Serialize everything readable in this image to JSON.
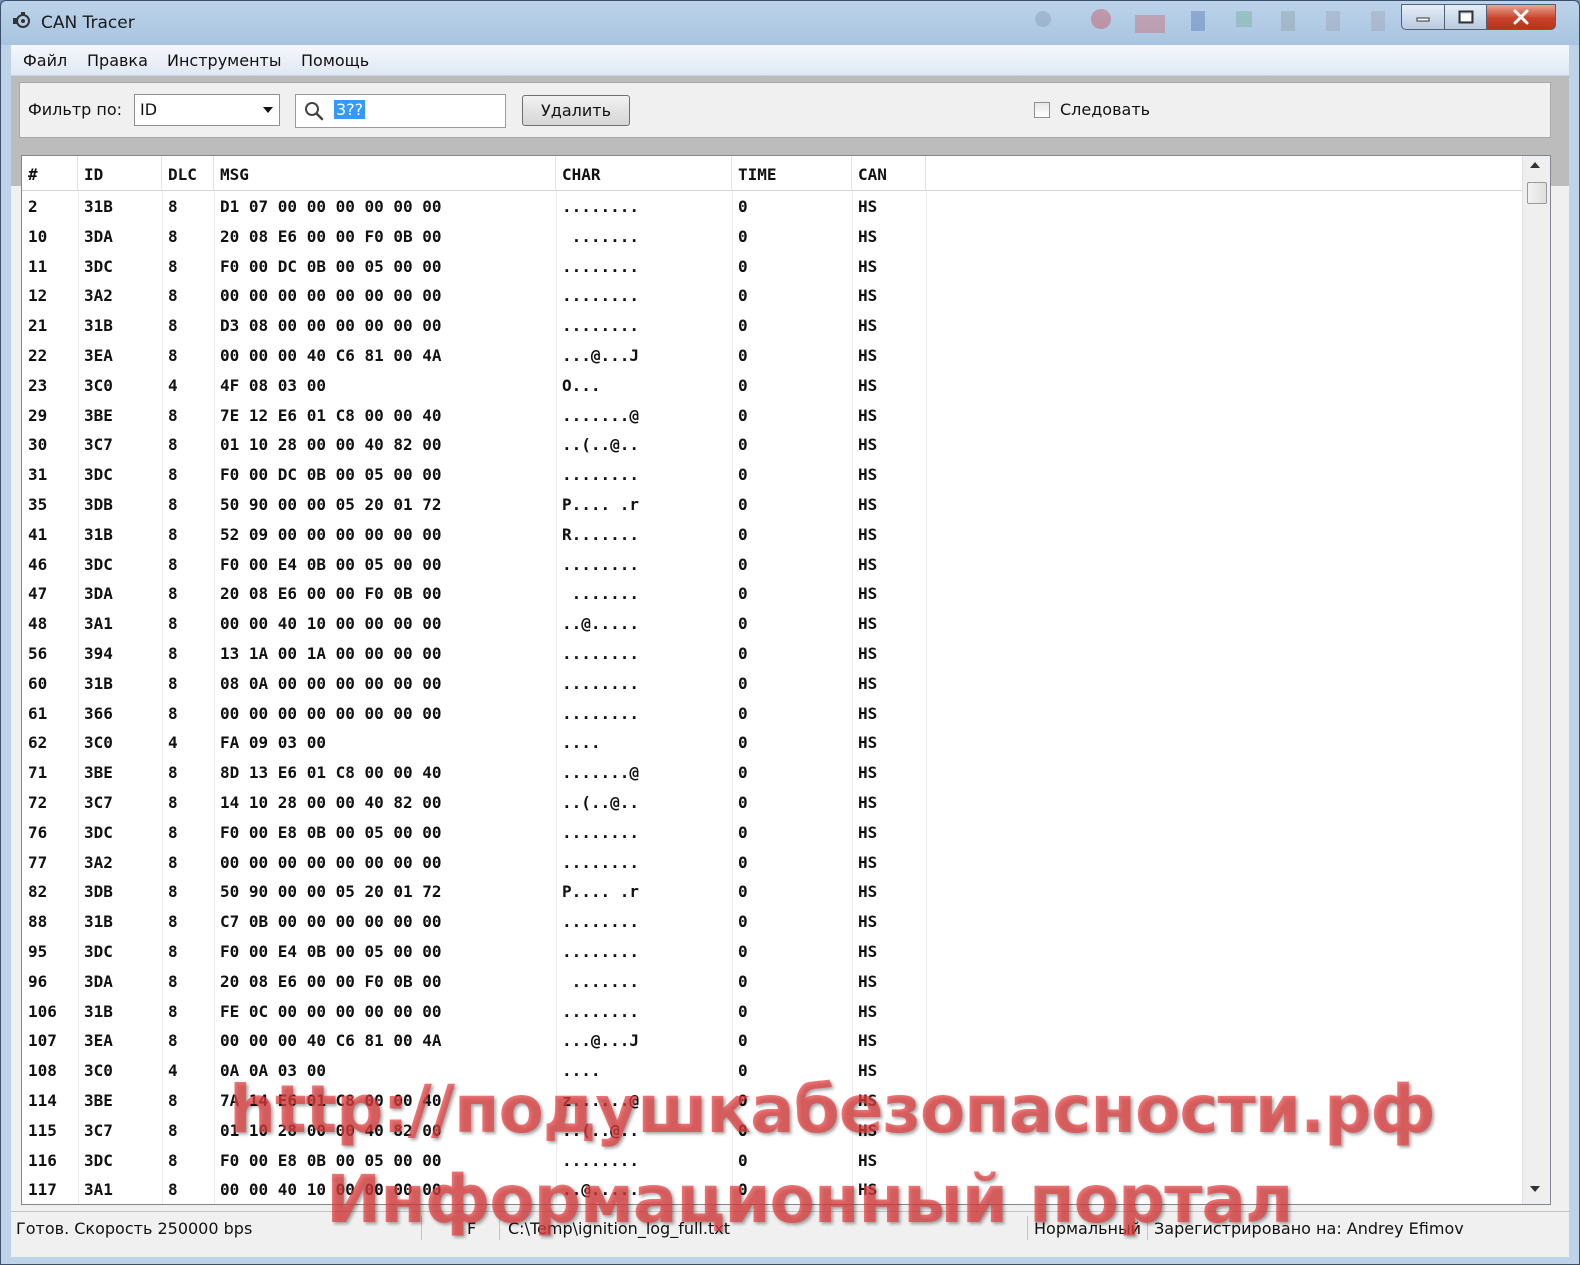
{
  "window": {
    "title": "CAN Tracer"
  },
  "menu": [
    "Файл",
    "Правка",
    "Инструменты",
    "Помощь"
  ],
  "filter": {
    "label": "Фильтр по:",
    "field_value": "ID",
    "search_value": "3??",
    "delete_label": "Удалить",
    "follow_label": "Следовать",
    "follow_checked": false
  },
  "table": {
    "columns": [
      "#",
      "ID",
      "DLC",
      "MSG",
      "CHAR",
      "TIME",
      "CAN"
    ],
    "rows": [
      [
        "2",
        "31B",
        "8",
        "D1 07 00 00 00 00 00 00",
        "........",
        "0",
        "HS"
      ],
      [
        "10",
        "3DA",
        "8",
        "20 08 E6 00 00 F0 0B 00",
        " .......",
        "0",
        "HS"
      ],
      [
        "11",
        "3DC",
        "8",
        "F0 00 DC 0B 00 05 00 00",
        "........",
        "0",
        "HS"
      ],
      [
        "12",
        "3A2",
        "8",
        "00 00 00 00 00 00 00 00",
        "........",
        "0",
        "HS"
      ],
      [
        "21",
        "31B",
        "8",
        "D3 08 00 00 00 00 00 00",
        "........",
        "0",
        "HS"
      ],
      [
        "22",
        "3EA",
        "8",
        "00 00 00 40 C6 81 00 4A",
        "...@...J",
        "0",
        "HS"
      ],
      [
        "23",
        "3C0",
        "4",
        "4F 08 03 00",
        "O...",
        "0",
        "HS"
      ],
      [
        "29",
        "3BE",
        "8",
        "7E 12 E6 01 C8 00 00 40",
        ".......@",
        "0",
        "HS"
      ],
      [
        "30",
        "3C7",
        "8",
        "01 10 28 00 00 40 82 00",
        "..(..@..",
        "0",
        "HS"
      ],
      [
        "31",
        "3DC",
        "8",
        "F0 00 DC 0B 00 05 00 00",
        "........",
        "0",
        "HS"
      ],
      [
        "35",
        "3DB",
        "8",
        "50 90 00 00 05 20 01 72",
        "P.... .r",
        "0",
        "HS"
      ],
      [
        "41",
        "31B",
        "8",
        "52 09 00 00 00 00 00 00",
        "R.......",
        "0",
        "HS"
      ],
      [
        "46",
        "3DC",
        "8",
        "F0 00 E4 0B 00 05 00 00",
        "........",
        "0",
        "HS"
      ],
      [
        "47",
        "3DA",
        "8",
        "20 08 E6 00 00 F0 0B 00",
        " .......",
        "0",
        "HS"
      ],
      [
        "48",
        "3A1",
        "8",
        "00 00 40 10 00 00 00 00",
        "..@.....",
        "0",
        "HS"
      ],
      [
        "56",
        "394",
        "8",
        "13 1A 00 1A 00 00 00 00",
        "........",
        "0",
        "HS"
      ],
      [
        "60",
        "31B",
        "8",
        "08 0A 00 00 00 00 00 00",
        "........",
        "0",
        "HS"
      ],
      [
        "61",
        "366",
        "8",
        "00 00 00 00 00 00 00 00",
        "........",
        "0",
        "HS"
      ],
      [
        "62",
        "3C0",
        "4",
        "FA 09 03 00",
        "....",
        "0",
        "HS"
      ],
      [
        "71",
        "3BE",
        "8",
        "8D 13 E6 01 C8 00 00 40",
        ".......@",
        "0",
        "HS"
      ],
      [
        "72",
        "3C7",
        "8",
        "14 10 28 00 00 40 82 00",
        "..(..@..",
        "0",
        "HS"
      ],
      [
        "76",
        "3DC",
        "8",
        "F0 00 E8 0B 00 05 00 00",
        "........",
        "0",
        "HS"
      ],
      [
        "77",
        "3A2",
        "8",
        "00 00 00 00 00 00 00 00",
        "........",
        "0",
        "HS"
      ],
      [
        "82",
        "3DB",
        "8",
        "50 90 00 00 05 20 01 72",
        "P.... .r",
        "0",
        "HS"
      ],
      [
        "88",
        "31B",
        "8",
        "C7 0B 00 00 00 00 00 00",
        "........",
        "0",
        "HS"
      ],
      [
        "95",
        "3DC",
        "8",
        "F0 00 E4 0B 00 05 00 00",
        "........",
        "0",
        "HS"
      ],
      [
        "96",
        "3DA",
        "8",
        "20 08 E6 00 00 F0 0B 00",
        " .......",
        "0",
        "HS"
      ],
      [
        "106",
        "31B",
        "8",
        "FE 0C 00 00 00 00 00 00",
        "........",
        "0",
        "HS"
      ],
      [
        "107",
        "3EA",
        "8",
        "00 00 00 40 C6 81 00 4A",
        "...@...J",
        "0",
        "HS"
      ],
      [
        "108",
        "3C0",
        "4",
        "0A 0A 03 00",
        "....",
        "0",
        "HS"
      ],
      [
        "114",
        "3BE",
        "8",
        "7A 14 E6 01 C8 00 00 40",
        "z......@",
        "0",
        "HS"
      ],
      [
        "115",
        "3C7",
        "8",
        "01 10 28 00 00 40 82 00",
        "..(..@..",
        "0",
        "HS"
      ],
      [
        "116",
        "3DC",
        "8",
        "F0 00 E8 0B 00 05 00 00",
        "........",
        "0",
        "HS"
      ],
      [
        "117",
        "3A1",
        "8",
        "00 00 40 10 00 00 00 00",
        "..@.....",
        "0",
        "HS"
      ]
    ]
  },
  "status": {
    "ready": "Готов. Скорость 250000 bps",
    "flag": "F",
    "file": "C:\\Temp\\ignition_log_full.txt",
    "mode": "Нормальный",
    "registered": "Зарегистрировано на: Andrey Efimov"
  },
  "watermark": {
    "line1": "http://подушкабезопасности.рф",
    "line2": "Информационный портал"
  },
  "colors": {
    "selection": "#3399ff",
    "close_button": "#c8432a",
    "watermark": "#e84040"
  }
}
